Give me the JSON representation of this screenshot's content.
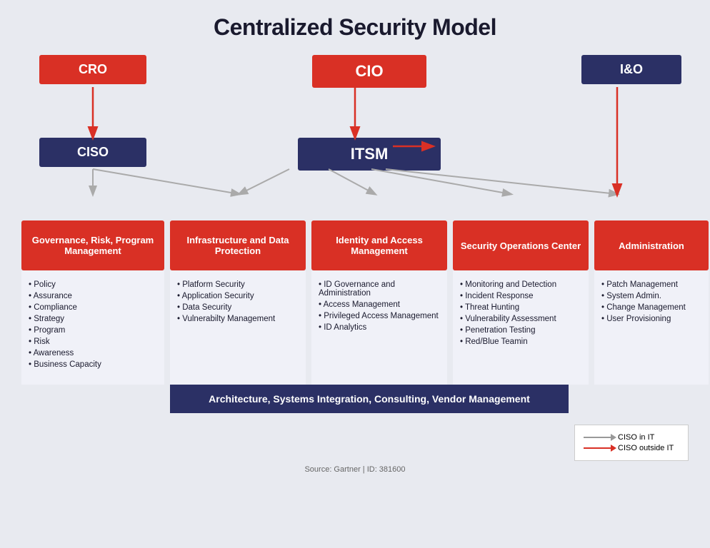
{
  "title": "Centralized Security Model",
  "nodes": {
    "cro": "CRO",
    "cio": "CIO",
    "ciso": "CISO",
    "itsm": "ITSM",
    "io": "I&O"
  },
  "categories": [
    {
      "id": "gov",
      "label": "Governance, Risk, Program Management",
      "bullets": [
        "Policy",
        "Assurance",
        "Compliance",
        "Strategy",
        "Program",
        "Risk",
        "Awareness",
        "Business Capacity"
      ]
    },
    {
      "id": "infra",
      "label": "Infrastructure and Data Protection",
      "bullets": [
        "Platform Security",
        "Application Security",
        "Data Security",
        "Vulnerabilty Management"
      ]
    },
    {
      "id": "iam",
      "label": "Identity and Access Management",
      "bullets": [
        "ID Governance and Administration",
        "Access Management",
        "Privileged Access Management",
        "ID Analytics"
      ]
    },
    {
      "id": "soc",
      "label": "Security Operations Center",
      "bullets": [
        "Monitoring and Detection",
        "Incident Response",
        "Threat Hunting",
        "Vulnerability Assessment",
        "Penetration Testing",
        "Red/Blue Teamin"
      ]
    },
    {
      "id": "admin",
      "label": "Administration",
      "bullets": [
        "Patch Management",
        "System Admin.",
        "Change Management",
        "User Provisioning"
      ]
    }
  ],
  "arch_bar": "Architecture, Systems Integration, Consulting, Vendor Management",
  "legend": {
    "gray_label": "CISO in IT",
    "red_label": "CISO outside IT"
  },
  "source": "Source: Gartner | ID: 381600"
}
